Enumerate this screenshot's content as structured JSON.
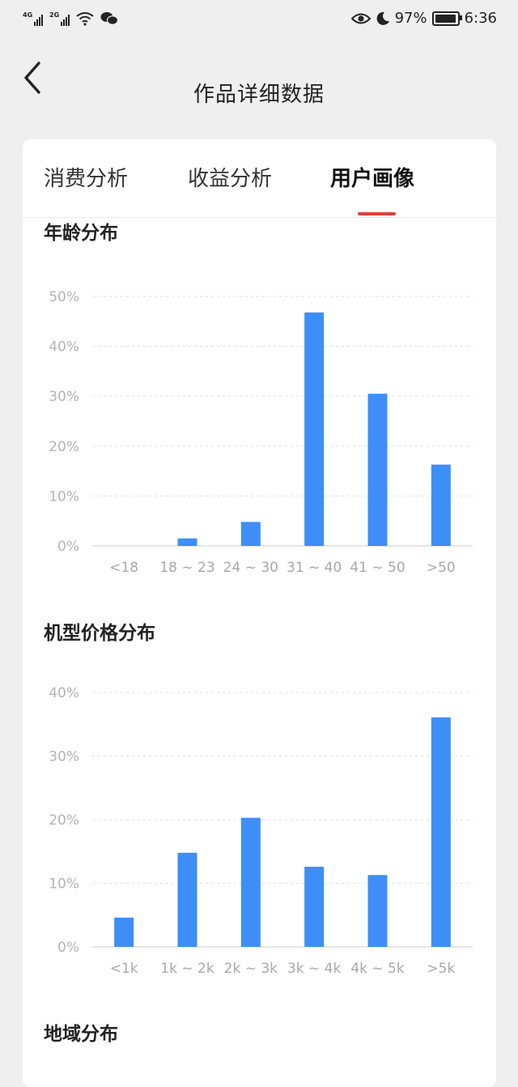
{
  "status_bar": {
    "signal1_label": "4G",
    "signal2_label": "2G",
    "battery_percent": "97%",
    "battery_level": 0.97,
    "time": "6:36",
    "icons": [
      "signal-icon",
      "signal-icon",
      "wifi-icon",
      "wechat-icon",
      "eye-icon",
      "moon-icon",
      "battery-icon"
    ]
  },
  "header": {
    "title": "作品详细数据"
  },
  "tabs": [
    {
      "label": "消费分析"
    },
    {
      "label": "收益分析"
    },
    {
      "label": "用户画像"
    }
  ],
  "active_tab": 2,
  "sections": {
    "age": {
      "title": "年龄分布"
    },
    "price": {
      "title": "机型价格分布"
    },
    "region": {
      "title": "地域分布"
    }
  },
  "colors": {
    "bar": "#3d8ef7",
    "tab_indicator": "#e0403c"
  },
  "chart_data": [
    {
      "type": "bar",
      "categories": [
        "<18",
        "18 ~ 23",
        "24 ~ 30",
        "31 ~ 40",
        "41 ~ 50",
        ">50"
      ],
      "values": [
        0,
        1.5,
        4.8,
        46.8,
        30.5,
        16.3
      ],
      "yticks": [
        "0%",
        "10%",
        "20%",
        "30%",
        "40%",
        "50%"
      ],
      "ylim": [
        0,
        50
      ],
      "grid": true
    },
    {
      "type": "bar",
      "categories": [
        "<1k",
        "1k ~ 2k",
        "2k ~ 3k",
        "3k ~ 4k",
        "4k ~ 5k",
        ">5k"
      ],
      "values": [
        4.6,
        14.8,
        20.3,
        12.6,
        11.3,
        36.1
      ],
      "yticks": [
        "0%",
        "10%",
        "20%",
        "30%",
        "40%"
      ],
      "ylim": [
        0,
        40
      ],
      "grid": true
    }
  ]
}
